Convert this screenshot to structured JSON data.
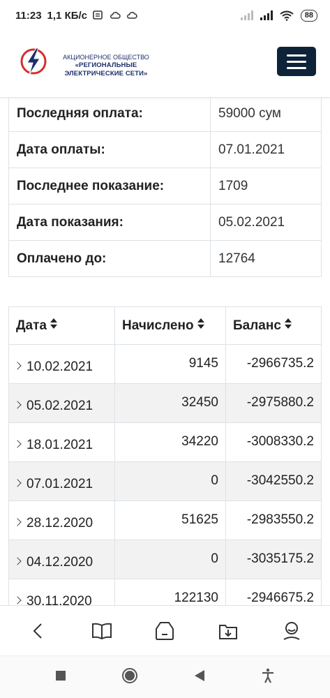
{
  "status_bar": {
    "time": "11:23",
    "net_speed": "1,1 КБ/с",
    "battery": "88"
  },
  "header": {
    "brand_line1": "АКЦИОНЕРНОЕ ОБЩЕСТВО",
    "brand_line2": "«РЕГИОНАЛЬНЫЕ ЭЛЕКТРИЧЕСКИЕ СЕТИ»",
    "menu_icon": "hamburger-menu-icon"
  },
  "info": [
    {
      "label": "Последняя оплата:",
      "value": "59000 сум"
    },
    {
      "label": "Дата оплаты:",
      "value": "07.01.2021"
    },
    {
      "label": "Последнее показание:",
      "value": "1709"
    },
    {
      "label": "Дата показания:",
      "value": "05.02.2021"
    },
    {
      "label": "Оплачено до:",
      "value": "12764"
    }
  ],
  "history": {
    "columns": [
      "Дата",
      "Начислено",
      "Баланс"
    ],
    "rows": [
      {
        "date": "10.02.2021",
        "charged": "9145",
        "balance": "-2966735.2"
      },
      {
        "date": "05.02.2021",
        "charged": "32450",
        "balance": "-2975880.2"
      },
      {
        "date": "18.01.2021",
        "charged": "34220",
        "balance": "-3008330.2"
      },
      {
        "date": "07.01.2021",
        "charged": "0",
        "balance": "-3042550.2"
      },
      {
        "date": "28.12.2020",
        "charged": "51625",
        "balance": "-2983550.2"
      },
      {
        "date": "04.12.2020",
        "charged": "0",
        "balance": "-3035175.2"
      },
      {
        "date": "30.11.2020",
        "charged": "122130",
        "balance": "-2946675.2"
      }
    ]
  },
  "toolbar": {
    "icons": [
      "back-icon",
      "bookmarks-icon",
      "tabs-icon",
      "downloads-icon",
      "profile-icon"
    ]
  },
  "colors": {
    "brand_navy": "#1d2f6b",
    "menu_button": "#0f2338",
    "logo_red": "#d32f2f",
    "row_stripe": "#f2f2f2"
  }
}
